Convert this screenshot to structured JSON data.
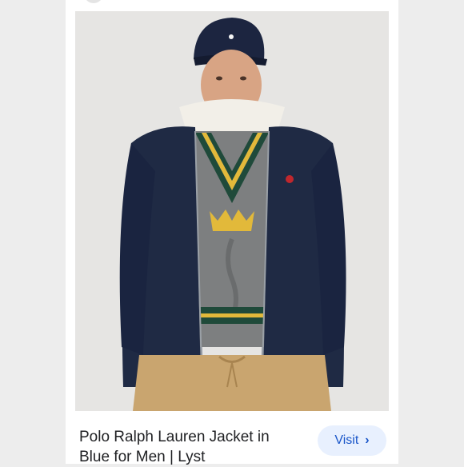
{
  "result": {
    "title": "Polo Ralph Lauren Jacket in Blue for Men | Lyst",
    "visit_label": "Visit",
    "visit_icon": "chevron-right-icon"
  },
  "image": {
    "subject": "product-photo",
    "colors": {
      "background": "#e6e5e3",
      "jacket": "#1f2a44",
      "cap": "#1c2540",
      "sweater": "#7d7f80",
      "stripe_yellow": "#e2b93a",
      "stripe_green": "#1f4a3a",
      "chinos": "#c9a56f",
      "collar": "#f2efe8",
      "logo_red": "#c0272d",
      "skin": "#d8a484"
    }
  }
}
